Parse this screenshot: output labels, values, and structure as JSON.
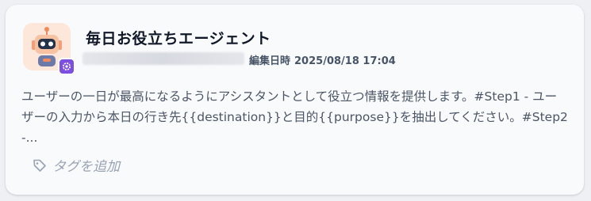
{
  "agent_card": {
    "title": "毎日お役立ちエージェント",
    "author": "",
    "edited_label": "編集日時",
    "edited_at": "2025/08/18 17:04",
    "description": "ユーザーの一日が最高になるようにアシスタントとして役立つ情報を提供します。#Step1 - ユーザーの入力から本日の行き先{{destination}}と目的{{purpose}}を抽出してください。#Step2 -...",
    "add_tag_label": "タグを追加"
  },
  "icons": {
    "avatar": "robot-icon",
    "badge": "agent-badge-icon",
    "tag": "tag-icon"
  },
  "colors": {
    "accent": "#7c4fe0",
    "avatar_bg": "#fde7da",
    "title": "#101828",
    "muted": "#98a2b3"
  }
}
